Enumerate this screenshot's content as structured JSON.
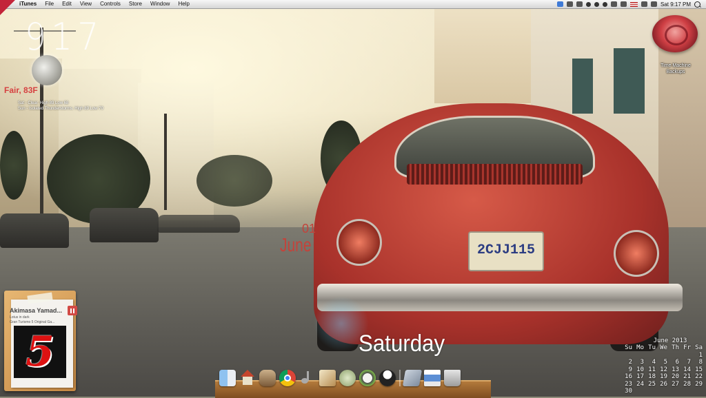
{
  "menubar": {
    "app_name": "iTunes",
    "items": [
      "File",
      "Edit",
      "View",
      "Controls",
      "Store",
      "Window",
      "Help"
    ],
    "clock": "Sat 9:17 PM"
  },
  "weather": {
    "time": "917",
    "current_temp": "Fair, 83F",
    "forecast_line1": "Sat - Clear. High 89 Low 68",
    "forecast_line2": "Sun - Isolated Thunderstorms. High 89 Low 70"
  },
  "date": {
    "day_number": "01",
    "month": "June",
    "weekday": "Saturday"
  },
  "time_machine": {
    "label_line1": "Time Machine",
    "label_line2": "Backups"
  },
  "itunes_widget": {
    "artist": "Akimasa Yamad...",
    "song_line1": "Lotus in dark",
    "song_line2": "Gran Turismo 5 Original Ga...",
    "album_glyph": "5"
  },
  "wallpaper": {
    "plate_text": "2CJJ115"
  },
  "calendar": {
    "title": "June 2013",
    "weekdays": [
      "Su",
      "Mo",
      "Tu",
      "We",
      "Th",
      "Fr",
      "Sa"
    ],
    "days": [
      "",
      "",
      "",
      "",
      "",
      "",
      "1",
      "2",
      "3",
      "4",
      "5",
      "6",
      "7",
      "8",
      "9",
      "10",
      "11",
      "12",
      "13",
      "14",
      "15",
      "16",
      "17",
      "18",
      "19",
      "20",
      "21",
      "22",
      "23",
      "24",
      "25",
      "26",
      "27",
      "28",
      "29",
      "30",
      "",
      "",
      "",
      "",
      "",
      ""
    ]
  },
  "dock": {
    "icons": [
      "finder-icon",
      "home-icon",
      "drive-icon",
      "chrome-icon",
      "music-icon",
      "notes-icon",
      "face-icon",
      "gauge-icon",
      "tux-icon",
      "drawer-icon",
      "photo-icon",
      "trash-icon"
    ]
  }
}
